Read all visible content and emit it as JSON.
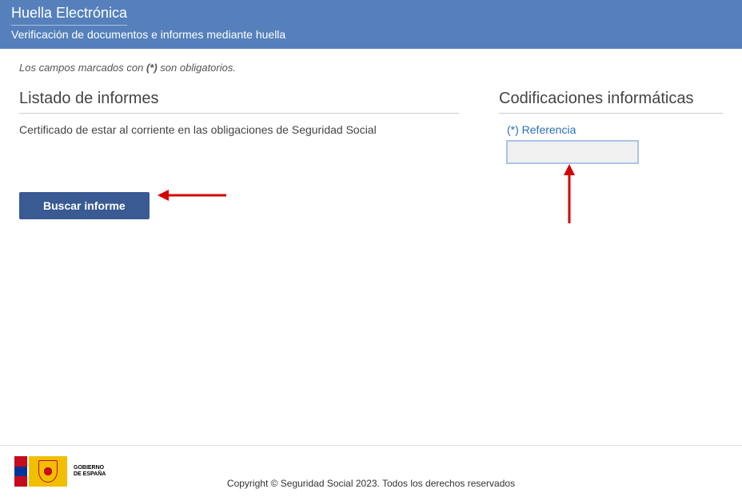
{
  "header": {
    "title": "Huella Electrónica",
    "subtitle": "Verificación de documentos e informes mediante huella"
  },
  "required_note": {
    "prefix": "Los campos marcados con ",
    "marker": "(*)",
    "suffix": " son obligatorios."
  },
  "left": {
    "section_title": "Listado de informes",
    "report_item": "Certificado de estar al corriente en las obligaciones de Seguridad Social",
    "button_label": "Buscar informe"
  },
  "right": {
    "section_title": "Codificaciones informáticas",
    "field_label": "(*) Referencia",
    "field_value": ""
  },
  "footer": {
    "gov_line1": "GOBIERNO",
    "gov_line2": "DE ESPAÑA",
    "copyright": "Copyright © Seguridad Social 2023. Todos los derechos reservados"
  }
}
